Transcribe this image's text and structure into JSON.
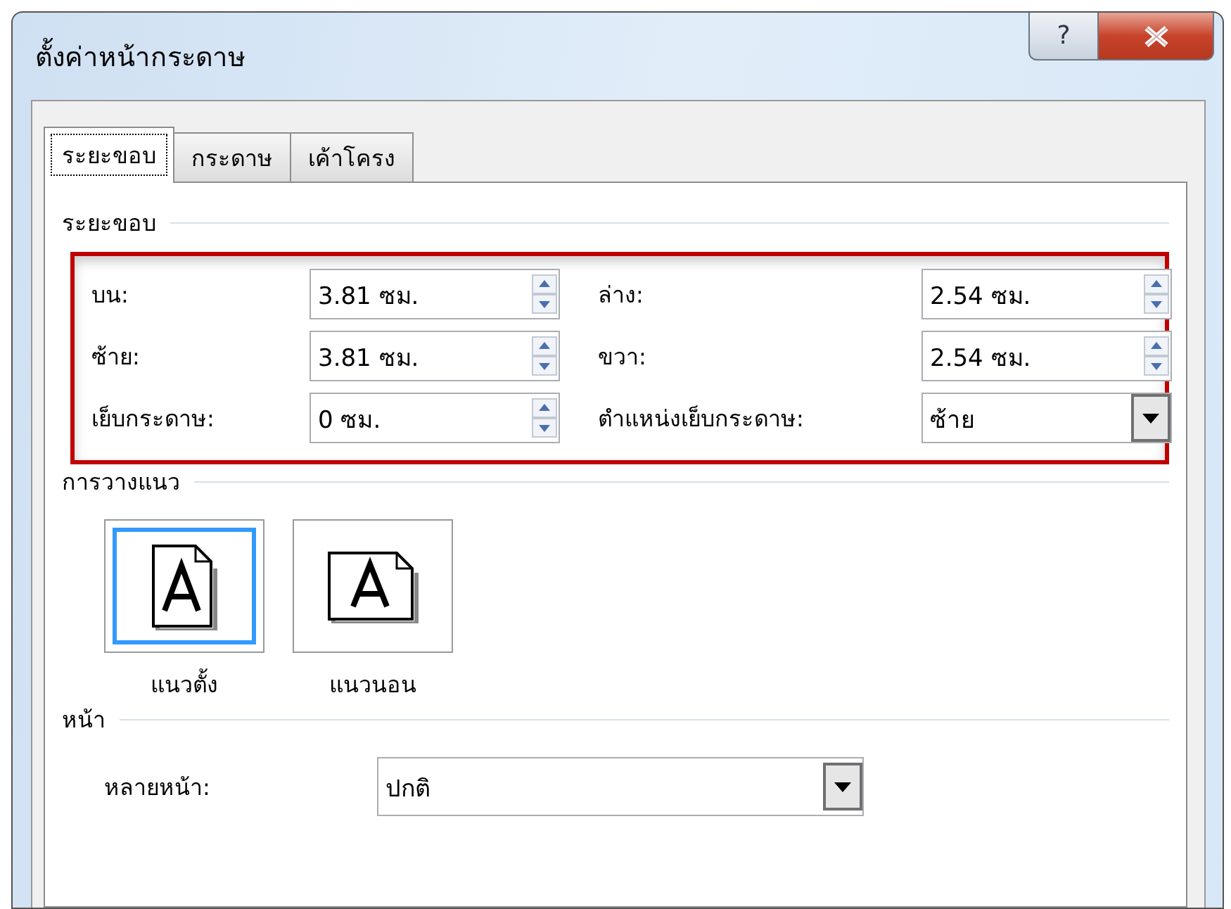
{
  "window": {
    "title": "ตั้งค่าหน้ากระดาษ",
    "help_button": "?"
  },
  "tabs": [
    {
      "label": "ระยะขอบ",
      "selected": true
    },
    {
      "label": "กระดาษ",
      "selected": false
    },
    {
      "label": "เค้าโครง",
      "selected": false
    }
  ],
  "margins": {
    "heading": "ระยะขอบ",
    "fields": [
      {
        "kind": "spin",
        "label": "บน:",
        "value": "3.81 ซม."
      },
      {
        "kind": "spin",
        "label": "ล่าง:",
        "value": "2.54 ซม."
      },
      {
        "kind": "spin",
        "label": "ซ้าย:",
        "value": "3.81 ซม."
      },
      {
        "kind": "spin",
        "label": "ขวา:",
        "value": "2.54 ซม."
      },
      {
        "kind": "spin",
        "label": "เย็บกระดาษ:",
        "value": "0 ซม."
      },
      {
        "kind": "dropdown",
        "label": "ตำแหน่งเย็บกระดาษ:",
        "value": "ซ้าย"
      }
    ]
  },
  "orientation": {
    "heading": "การวางแนว",
    "options": [
      {
        "kind": "portrait",
        "label": "แนวตั้ง",
        "selected": true
      },
      {
        "kind": "landscape",
        "label": "แนวนอน",
        "selected": false
      }
    ]
  },
  "pages": {
    "heading": "หน้า",
    "label": "หลายหน้า:",
    "value": "ปกติ"
  }
}
